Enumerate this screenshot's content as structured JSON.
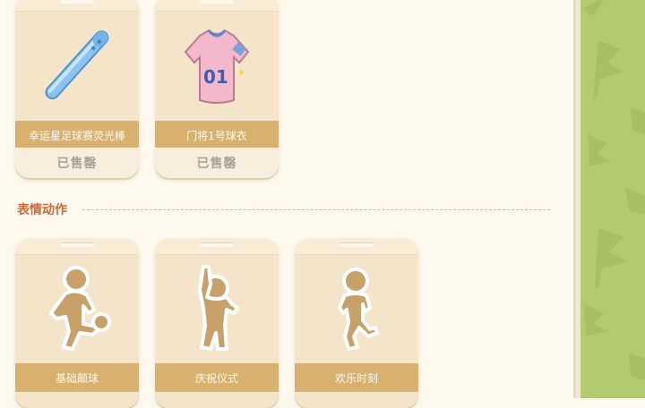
{
  "items": [
    {
      "name": "幸运星足球赛荧光棒",
      "status": "已售罄",
      "icon": "glow-stick-icon"
    },
    {
      "name": "门将1号球衣",
      "status": "已售罄",
      "icon": "jersey-icon",
      "jersey_number": "01"
    }
  ],
  "section": {
    "title": "表情动作"
  },
  "emotes": [
    {
      "name": "基础颠球",
      "icon": "kick-ball-pose-icon"
    },
    {
      "name": "庆祝仪式",
      "icon": "celebrate-pose-icon"
    },
    {
      "name": "欢乐时刻",
      "icon": "happy-pose-icon"
    }
  ],
  "colors": {
    "card_bg": "#f4e4c9",
    "name_bar": "#d8b16f",
    "section_title": "#d06a36",
    "side_panel": "#b2cb6e",
    "figure": "#c8a06a"
  }
}
